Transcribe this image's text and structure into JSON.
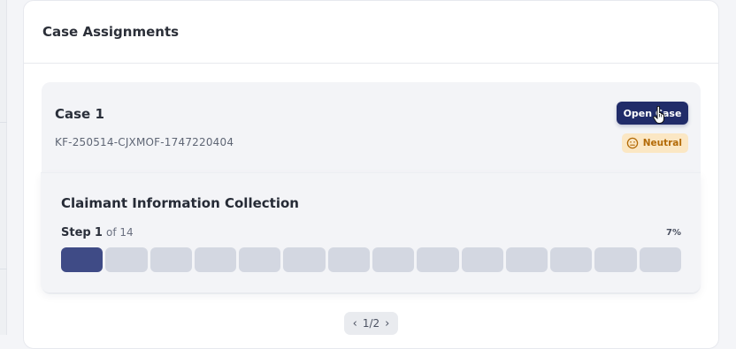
{
  "panel": {
    "title": "Case Assignments"
  },
  "case": {
    "title": "Case 1",
    "id": "KF-250514-CJXMOF-1747220404",
    "open_button": "Open Case",
    "sentiment": {
      "label": "Neutral",
      "icon": "neutral-face-icon",
      "bg": "#fbe7c4",
      "fg": "#b36a06"
    }
  },
  "progress": {
    "title": "Claimant Information Collection",
    "step_word": "Step",
    "current_step": "1",
    "total_text": "of 14",
    "percent": "7%",
    "total_steps": 14,
    "completed_steps": 1,
    "colors": {
      "done": "#3f4b86",
      "todo": "#d3d7e1"
    }
  },
  "pager": {
    "prev": "‹",
    "label": "1/2",
    "next": "›"
  },
  "colors": {
    "accent": "#212c69"
  }
}
